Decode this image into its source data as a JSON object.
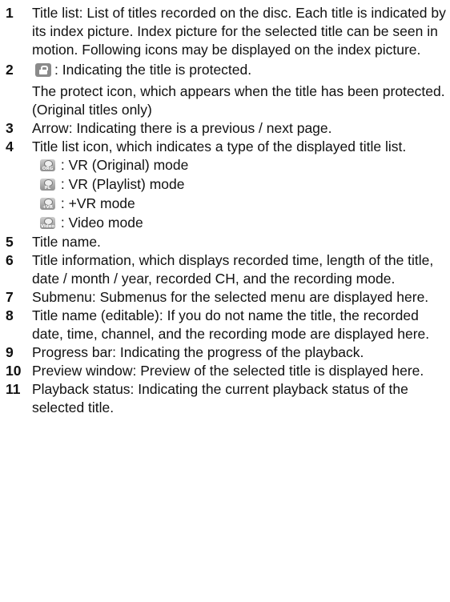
{
  "items": [
    {
      "num": "1",
      "text": "Title list: List of titles recorded on the disc. Each title is indicated by its index picture. Index picture for the selected title can be seen in motion. Following icons may be displayed on the index picture."
    },
    {
      "num": "2",
      "text": ": Indicating the title is protected.",
      "icon": "lock-icon",
      "sub": "The protect icon, which appears when the title has been protected. (Original titles only)"
    },
    {
      "num": "3",
      "text": "Arrow: Indicating there is a previous / next page."
    },
    {
      "num": "4",
      "text": "Title list icon, which indicates a type of the displayed title list.",
      "icons": [
        {
          "icon": "disc-org-icon",
          "tag": "ORG",
          "label": ": VR (Original) mode"
        },
        {
          "icon": "disc-pl-icon",
          "tag": "PL",
          "label": ": VR (Playlist) mode"
        },
        {
          "icon": "disc-plusvr-icon",
          "tag": "+VR",
          "label": ": +VR mode"
        },
        {
          "icon": "disc-video-icon",
          "tag": "Video",
          "label": ": Video mode"
        }
      ]
    },
    {
      "num": "5",
      "text": "Title name."
    },
    {
      "num": "6",
      "text": "Title information, which displays recorded time, length of the title, date / month / year, recorded CH, and the recording mode."
    },
    {
      "num": "7",
      "text": "Submenu: Submenus for the selected menu are displayed here."
    },
    {
      "num": "8",
      "text": "Title name (editable): If you do not name the title, the recorded date, time, channel, and the recording mode are displayed here."
    },
    {
      "num": "9",
      "text": "Progress bar: Indicating the progress of the playback."
    },
    {
      "num": "10",
      "text": "Preview window: Preview of the selected title is displayed here."
    },
    {
      "num": "11",
      "text": "Playback status: Indicating the current playback status of the selected title."
    }
  ]
}
